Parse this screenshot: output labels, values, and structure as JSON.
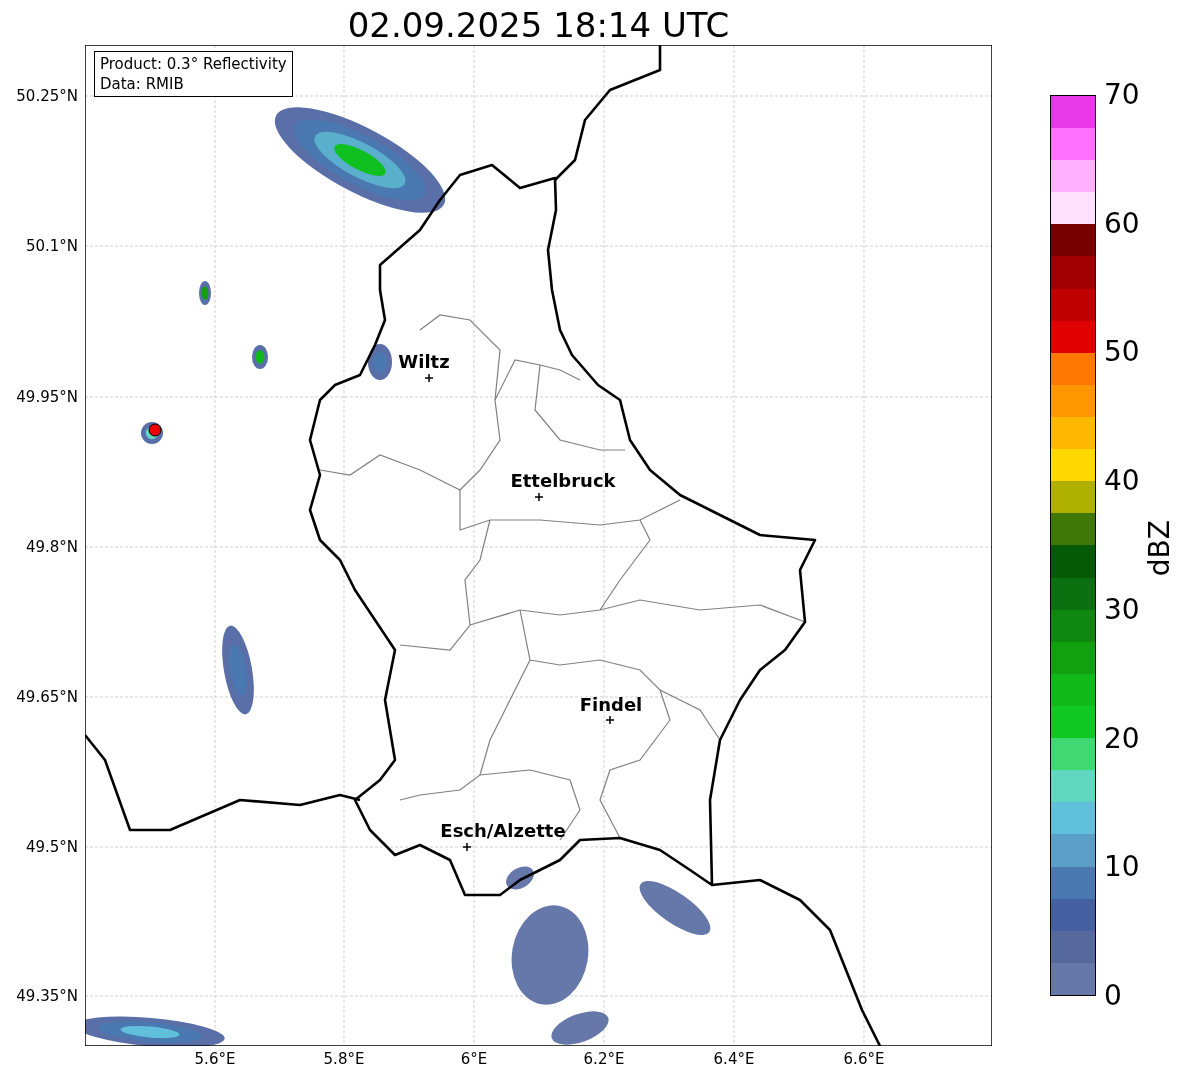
{
  "title": "02.09.2025 18:14 UTC",
  "info_box": {
    "lines": [
      "Product: 0.3° Reflectivity",
      "Data: RMIB"
    ]
  },
  "map": {
    "yticks": [
      "50.25°N",
      "50.1°N",
      "49.95°N",
      "49.8°N",
      "49.65°N",
      "49.5°N",
      "49.35°N"
    ],
    "xticks": [
      "5.6°E",
      "5.8°E",
      "6°E",
      "6.2°E",
      "6.4°E",
      "6.6°E"
    ],
    "cities": [
      {
        "name": "Wiltz"
      },
      {
        "name": "Ettelbruck"
      },
      {
        "name": "Findel"
      },
      {
        "name": "Esch/Alzette"
      }
    ]
  },
  "colorbar": {
    "label": "dBZ",
    "ticks": [
      "70",
      "60",
      "50",
      "40",
      "30",
      "20",
      "10",
      "0"
    ],
    "segments": [
      {
        "color": "#6677aa"
      },
      {
        "color": "#55699f"
      },
      {
        "color": "#4460a0"
      },
      {
        "color": "#4a78b0"
      },
      {
        "color": "#5a9fc8"
      },
      {
        "color": "#60c0dc"
      },
      {
        "color": "#60d8c0"
      },
      {
        "color": "#40d870"
      },
      {
        "color": "#10c820"
      },
      {
        "color": "#10b818"
      },
      {
        "color": "#10a010"
      },
      {
        "color": "#108810"
      },
      {
        "color": "#0a7010"
      },
      {
        "color": "#065a06"
      },
      {
        "color": "#407808"
      },
      {
        "color": "#b0b000"
      },
      {
        "color": "#ffd800"
      },
      {
        "color": "#ffb800"
      },
      {
        "color": "#ff9800"
      },
      {
        "color": "#ff7800"
      },
      {
        "color": "#e00000"
      },
      {
        "color": "#c00000"
      },
      {
        "color": "#a00000"
      },
      {
        "color": "#780000"
      },
      {
        "color": "#ffe0ff"
      },
      {
        "color": "#ffb0ff"
      },
      {
        "color": "#ff70ff"
      },
      {
        "color": "#e838e8"
      }
    ]
  }
}
